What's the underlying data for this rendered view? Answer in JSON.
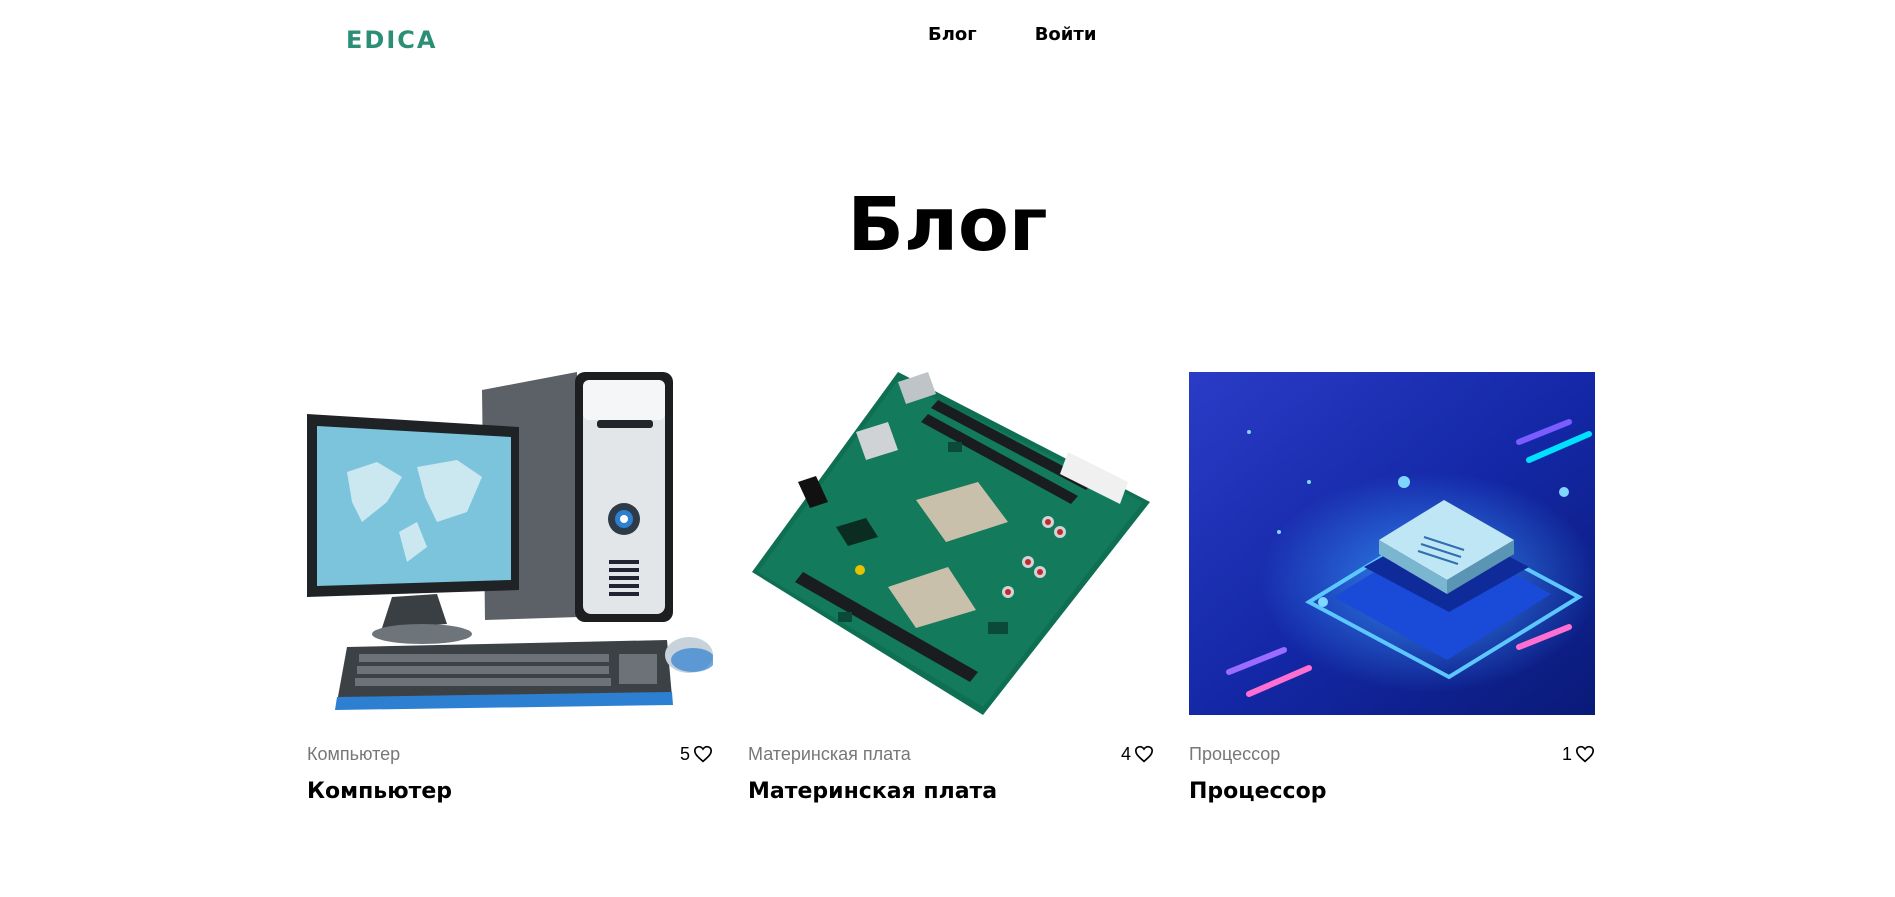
{
  "header": {
    "logo": "EDICA",
    "nav": [
      {
        "label": "Блог"
      },
      {
        "label": "Войти"
      }
    ]
  },
  "page": {
    "title": "Блог"
  },
  "posts": [
    {
      "category": "Компьютер",
      "likes": "5",
      "title": "Компьютер",
      "image": "computer-illustration"
    },
    {
      "category": "Материнская плата",
      "likes": "4",
      "title": "Материнская плата",
      "image": "motherboard-photo"
    },
    {
      "category": "Процессор",
      "likes": "1",
      "title": "Процессор",
      "image": "processor-illustration"
    }
  ],
  "colors": {
    "brand": "#2b8f78",
    "category_text": "#777777"
  }
}
